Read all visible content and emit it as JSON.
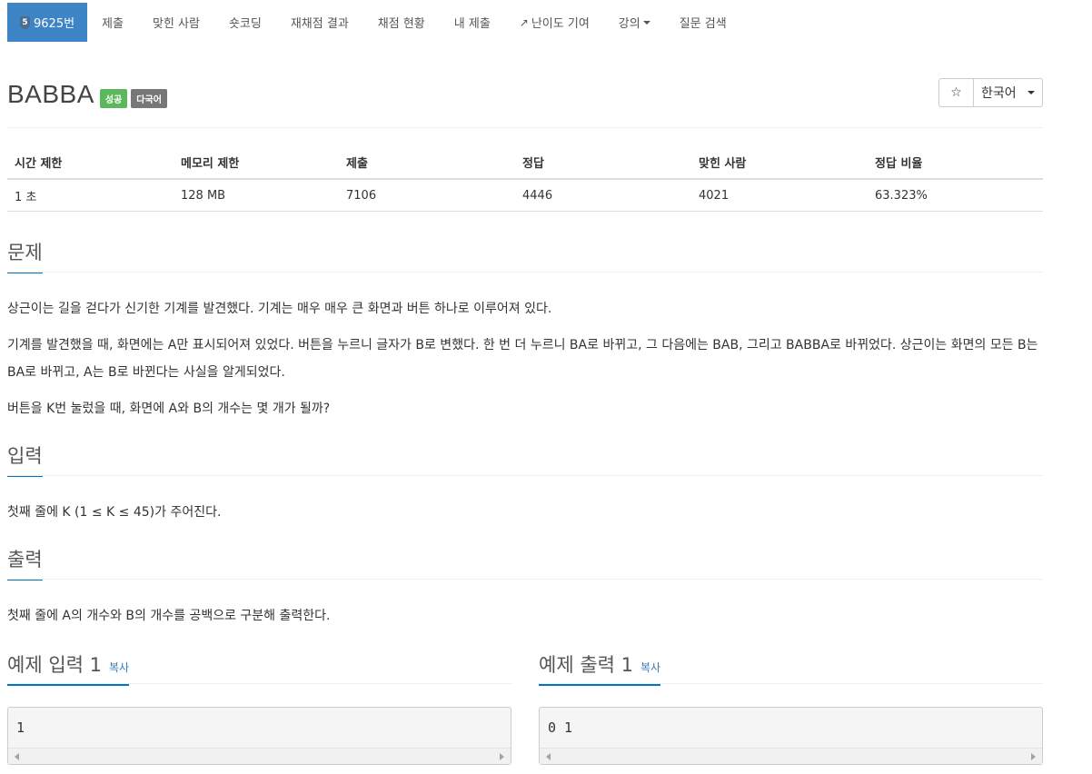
{
  "nav": {
    "problem": {
      "tier": "5",
      "number": "9625번"
    },
    "items": [
      "제출",
      "맞힌 사람",
      "숏코딩",
      "재채점 결과",
      "채점 현황",
      "내 제출"
    ],
    "difficulty": "난이도 기여",
    "lecture": "강의",
    "qna": "질문 검색"
  },
  "problem": {
    "title": "BABBA",
    "labels": {
      "status": "성공",
      "multilang": "다국어"
    },
    "star": "☆",
    "language": "한국어"
  },
  "stats": {
    "headers": [
      "시간 제한",
      "메모리 제한",
      "제출",
      "정답",
      "맞힌 사람",
      "정답 비율"
    ],
    "values": [
      "1 초",
      "128 MB",
      "7106",
      "4446",
      "4021",
      "63.323%"
    ]
  },
  "sections": {
    "description": {
      "title": "문제",
      "paragraphs": [
        "상근이는 길을 걷다가 신기한 기계를 발견했다. 기계는 매우 매우 큰 화면과 버튼 하나로 이루어져 있다.",
        "기계를 발견했을 때, 화면에는 A만 표시되어져 있었다. 버튼을 누르니 글자가 B로 변했다. 한 번 더 누르니 BA로 바뀌고, 그 다음에는 BAB, 그리고 BABBA로 바뀌었다. 상근이는 화면의 모든 B는 BA로 바뀌고, A는 B로 바뀐다는 사실을 알게되었다.",
        "버튼을 K번 눌렀을 때, 화면에 A와 B의 개수는 몇 개가 될까?"
      ]
    },
    "input": {
      "title": "입력",
      "text": "첫째 줄에 K (1 ≤ K ≤ 45)가 주어진다."
    },
    "output": {
      "title": "출력",
      "text": "첫째 줄에 A의 개수와 B의 개수를 공백으로 구분해 출력한다."
    }
  },
  "samples": {
    "input": {
      "title": "예제 입력 1",
      "copy": "복사",
      "content": "1"
    },
    "output": {
      "title": "예제 출력 1",
      "copy": "복사",
      "content": "0 1"
    }
  },
  "colors": {
    "accent": "#3e85c6",
    "success": "#5cb85c",
    "heading_underline": "#0076c0"
  }
}
